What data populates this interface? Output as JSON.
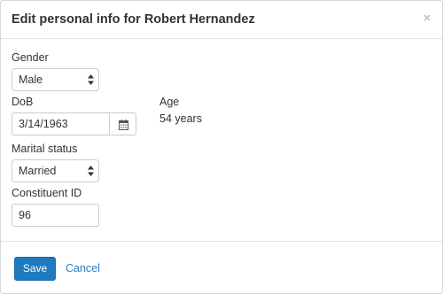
{
  "header": {
    "title": "Edit personal info for Robert Hernandez",
    "close_glyph": "×"
  },
  "form": {
    "gender": {
      "label": "Gender",
      "value": "Male"
    },
    "dob": {
      "label": "DoB",
      "value": "3/14/1963",
      "icon": "calendar-icon"
    },
    "age": {
      "label": "Age",
      "value": "54 years"
    },
    "marital_status": {
      "label": "Marital status",
      "value": "Married"
    },
    "constituent_id": {
      "label": "Constituent ID",
      "value": "96"
    }
  },
  "footer": {
    "save_label": "Save",
    "cancel_label": "Cancel"
  },
  "colors": {
    "primary": "#1f7bbf",
    "link": "#2a7fc9",
    "border": "#cccccc"
  }
}
